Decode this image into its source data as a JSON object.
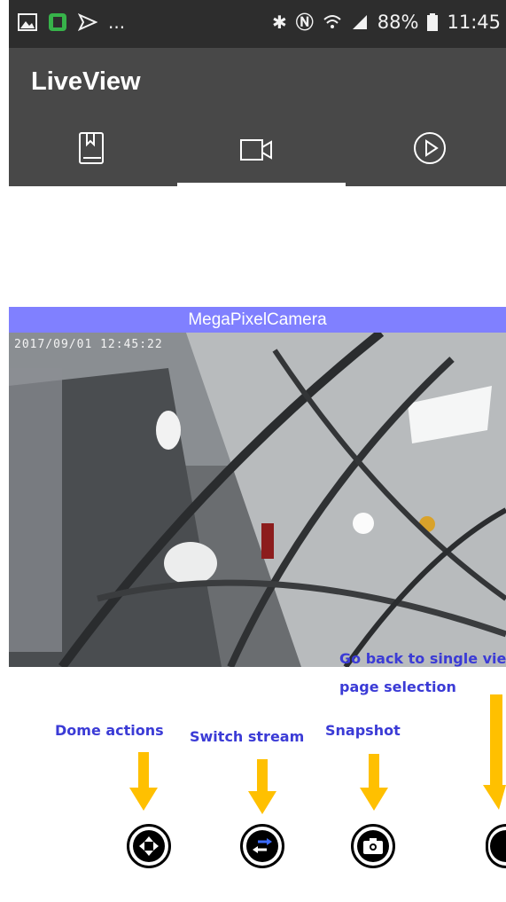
{
  "status_bar": {
    "left_icons": [
      "gallery-icon",
      "app-icon",
      "send-icon"
    ],
    "overflow": "...",
    "battery": "88%",
    "time": "11:45"
  },
  "app": {
    "title": "LiveView"
  },
  "tabs": [
    {
      "name": "bookmarks",
      "icon": "bookmark-book-icon"
    },
    {
      "name": "live",
      "icon": "video-camera-icon",
      "selected": true
    },
    {
      "name": "playback",
      "icon": "play-circle-icon"
    }
  ],
  "camera": {
    "title": "MegaPixelCamera",
    "timestamp": "2017/09/01 12:45:22"
  },
  "annotations": {
    "go_back_line1": "Go back to single view",
    "go_back_line2": "page selection",
    "dome": "Dome actions",
    "switch": "Switch stream",
    "snapshot": "Snapshot"
  },
  "colors": {
    "status_bar": "#2d2d2d",
    "app_bar": "#484848",
    "camera_title": "#8080ff",
    "annotation_text": "#3b3bd6",
    "arrow": "#ffc000"
  }
}
